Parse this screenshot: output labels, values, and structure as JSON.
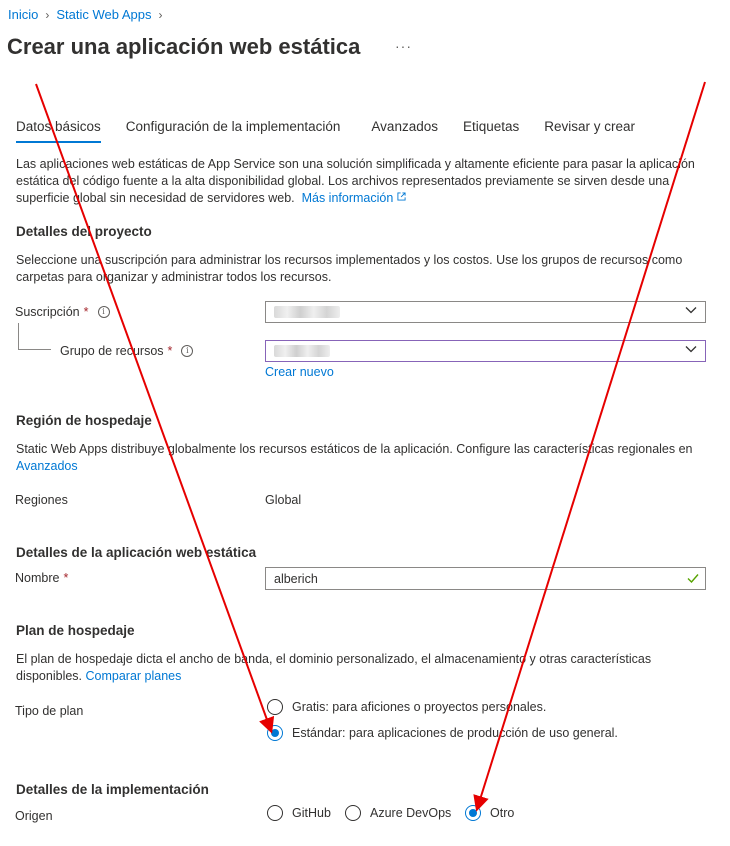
{
  "breadcrumb": {
    "items": [
      "Inicio",
      "Static Web Apps"
    ]
  },
  "page": {
    "title": "Crear una aplicación web estática",
    "more": "···"
  },
  "tabs": [
    "Datos básicos",
    "Configuración de la implementación",
    "Avanzados",
    "Etiquetas",
    "Revisar y crear"
  ],
  "intro": {
    "text": "Las aplicaciones web estáticas de App Service son una solución simplificada y altamente eficiente para pasar la aplicación estática del código fuente a la alta disponibilidad global. Los archivos representados previamente se sirven desde una superficie global sin necesidad de servidores web.",
    "link": "Más información"
  },
  "project": {
    "heading": "Detalles del proyecto",
    "text": "Seleccione una suscripción para administrar los recursos implementados y los costos. Use los grupos de recursos como carpetas para organizar y administrar todos los recursos.",
    "subscription_label": "Suscripción",
    "resource_group_label": "Grupo de recursos",
    "required": "*",
    "create_new": "Crear nuevo"
  },
  "hosting_region": {
    "heading": "Región de hospedaje",
    "text": "Static Web Apps distribuye globalmente los recursos estáticos de la aplicación. Configure las características regionales en",
    "link": "Avanzados",
    "regions_label": "Regiones",
    "regions_value": "Global"
  },
  "app_details": {
    "heading": "Detalles de la aplicación web estática",
    "name_label": "Nombre",
    "name_value": "alberich"
  },
  "plan": {
    "heading": "Plan de hospedaje",
    "text": "El plan de hospedaje dicta el ancho de banda, el dominio personalizado, el almacenamiento y otras características disponibles.",
    "link": "Comparar planes",
    "type_label": "Tipo de plan",
    "options": [
      "Gratis: para aficiones o proyectos personales.",
      "Estándar: para aplicaciones de producción de uso general."
    ],
    "selected": "Estándar: para aplicaciones de producción de uso general."
  },
  "deployment": {
    "heading": "Detalles de la implementación",
    "source_label": "Origen",
    "options": [
      "GitHub",
      "Azure DevOps",
      "Otro"
    ],
    "selected": "Otro"
  },
  "colors": {
    "accent": "#0078d4",
    "annotation_arrow": "#e60000",
    "required": "#a4262c",
    "valid": "#57a300"
  }
}
